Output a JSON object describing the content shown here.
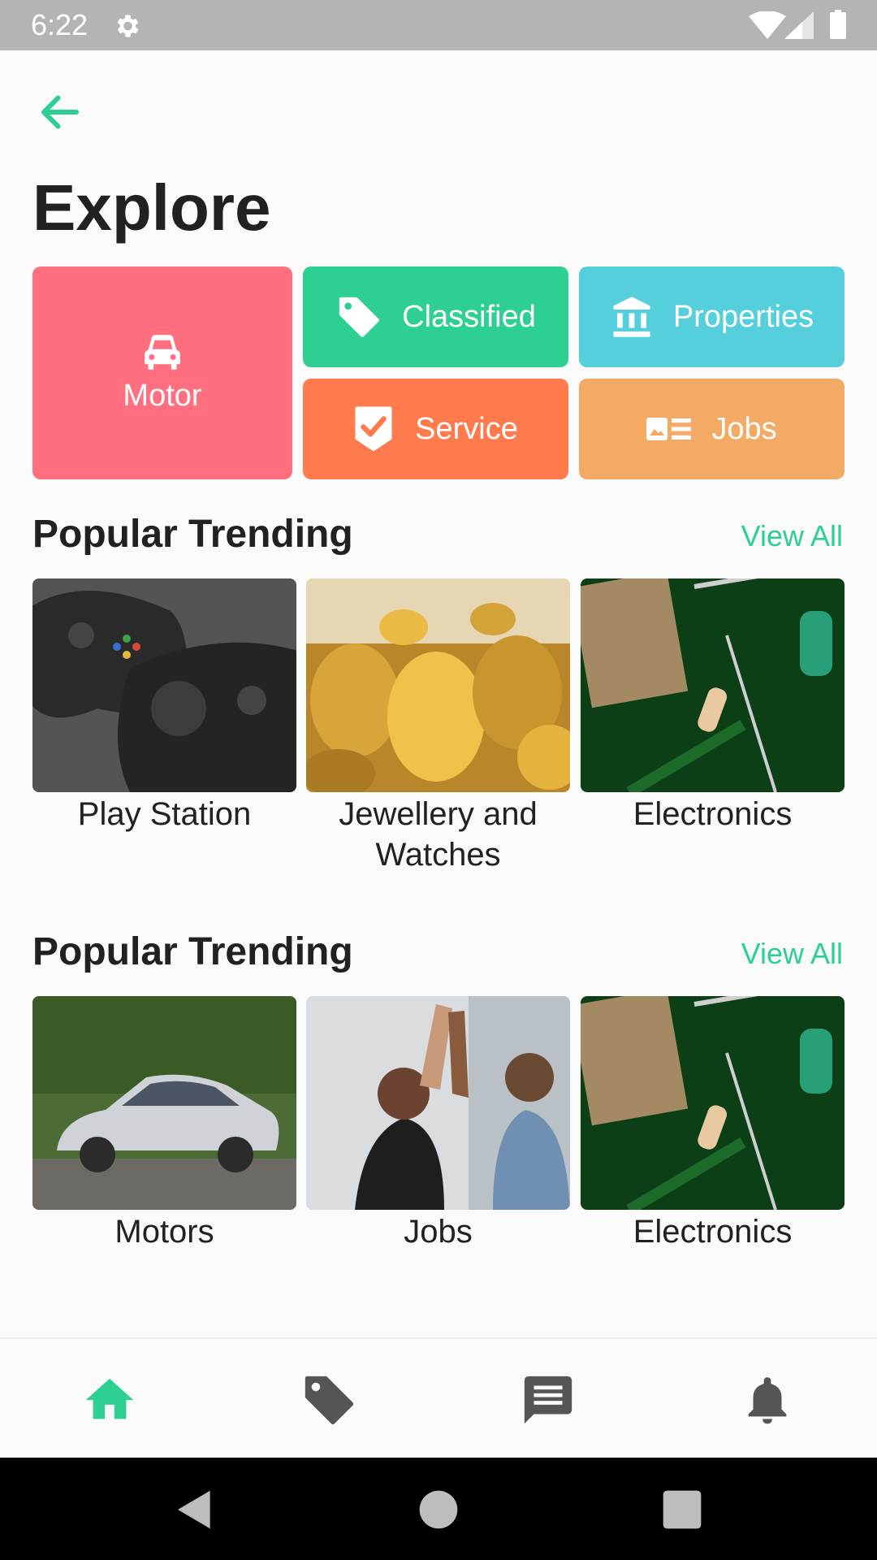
{
  "status_bar": {
    "time": "6:22"
  },
  "page": {
    "title": "Explore"
  },
  "categories": {
    "motor": "Motor",
    "classified": "Classified",
    "properties": "Properties",
    "service": "Service",
    "jobs": "Jobs"
  },
  "sections": [
    {
      "title": "Popular Trending",
      "view_all": "View All",
      "items": [
        {
          "label": "Play Station"
        },
        {
          "label": "Jewellery and Watches"
        },
        {
          "label": "Electronics"
        }
      ]
    },
    {
      "title": "Popular Trending",
      "view_all": "View All",
      "items": [
        {
          "label": "Motors"
        },
        {
          "label": "Jobs"
        },
        {
          "label": "Electronics"
        }
      ]
    }
  ],
  "bottom_nav": [
    {
      "icon": "home-icon",
      "active": true
    },
    {
      "icon": "tag-icon",
      "active": false
    },
    {
      "icon": "chat-icon",
      "active": false
    },
    {
      "icon": "bell-icon",
      "active": false
    }
  ],
  "colors": {
    "accent": "#2ecf92",
    "motor": "#ff6f7f",
    "classified": "#2ecf92",
    "properties": "#56cfdc",
    "service": "#ff7a4d",
    "jobs": "#f2aa65"
  }
}
